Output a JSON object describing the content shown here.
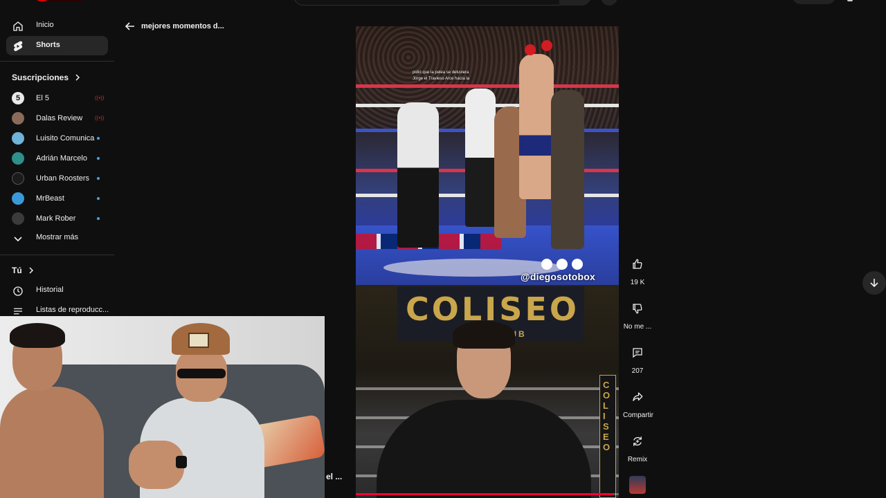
{
  "sidebar": {
    "nav": [
      {
        "label": "Inicio",
        "icon": "home-icon"
      },
      {
        "label": "Shorts",
        "icon": "shorts-icon",
        "active": true
      }
    ],
    "subscriptions_title": "Suscripciones",
    "subscriptions": [
      {
        "name": "El 5",
        "status": "live",
        "avatar_color": "#e9e9e9"
      },
      {
        "name": "Dalas Review",
        "status": "live",
        "avatar_color": "#8a6a5a"
      },
      {
        "name": "Luisito Comunica",
        "status": "new",
        "avatar_color": "#6fb3d9"
      },
      {
        "name": "Adrián Marcelo",
        "status": "new",
        "avatar_color": "#2f8f8a"
      },
      {
        "name": "Urban Roosters",
        "status": "new",
        "avatar_color": "#1b1b1b"
      },
      {
        "name": "MrBeast",
        "status": "new",
        "avatar_color": "#3a9ad9"
      },
      {
        "name": "Mark Rober",
        "status": "new",
        "avatar_color": "#3b3b3b"
      }
    ],
    "show_more": "Mostrar más",
    "you_title": "Tú",
    "you_items": [
      {
        "label": "Historial",
        "icon": "history-icon"
      },
      {
        "label": "Listas de reproducc...",
        "icon": "playlist-icon"
      }
    ]
  },
  "header": {
    "back_title": "mejores momentos d..."
  },
  "video": {
    "caption": [
      "pidió que la pelea se detuviera",
      "Jorge el Travieso Arce hacía la"
    ],
    "handle": "@diegosotobox",
    "sign_text": "COLISEO",
    "sign_sub": "BOX CLUB",
    "progress": 0.98,
    "progress_color": "#ff0033"
  },
  "actions": {
    "likes": "19 K",
    "dislike": "No me ...",
    "comments": "207",
    "share": "Compartir",
    "remix": "Remix"
  },
  "overlay_title": "el ..."
}
